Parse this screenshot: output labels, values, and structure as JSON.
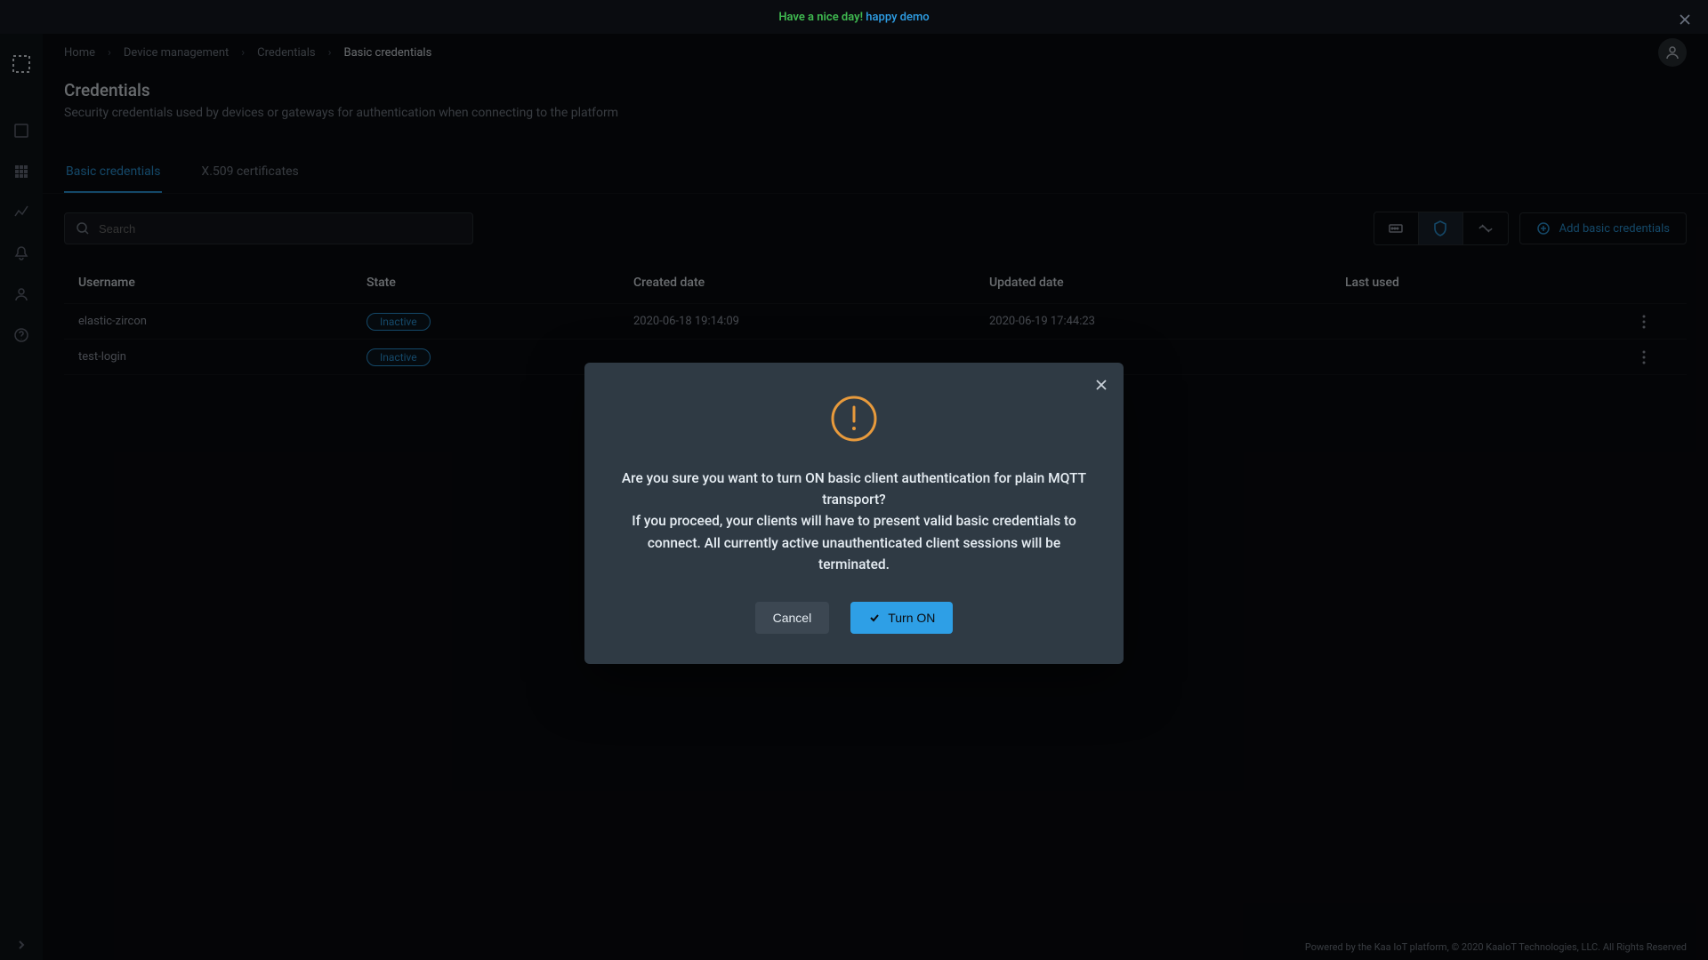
{
  "banner": {
    "greeting": "Have a nice day!",
    "link": "happy demo"
  },
  "breadcrumb": {
    "home": "Home",
    "devmgmt": "Device management",
    "credentials": "Credentials",
    "current": "Basic credentials"
  },
  "page": {
    "title": "Credentials",
    "subtitle": "Security credentials used by devices or gateways for authentication when connecting to the platform"
  },
  "tabs": {
    "basic": "Basic credentials",
    "x509": "X.509 certificates"
  },
  "search": {
    "placeholder": "Search"
  },
  "addBtn": "Add basic credentials",
  "columns": {
    "username": "Username",
    "state": "State",
    "created": "Created date",
    "updated": "Updated date",
    "lastused": "Last used"
  },
  "rows": [
    {
      "username": "elastic-zircon",
      "state": "Inactive",
      "created": "2020-06-18 19:14:09",
      "updated": "2020-06-19 17:44:23",
      "lastused": ""
    },
    {
      "username": "test-login",
      "state": "Inactive",
      "created": "",
      "updated": "",
      "lastused": ""
    }
  ],
  "dialog": {
    "line1": "Are you sure you want to turn ON basic client authentication for plain MQTT transport?",
    "line2": "If you proceed, your clients will have to present valid basic credentials to connect. All currently active unauthenticated client sessions will be terminated.",
    "cancel": "Cancel",
    "confirm": "Turn ON"
  },
  "footer": "Powered by the Kaa IoT platform, © 2020 KaaIoT Technologies, LLC. All Rights Reserved",
  "colors": {
    "accent": "#2e9fe6",
    "warn": "#e89a3c"
  }
}
